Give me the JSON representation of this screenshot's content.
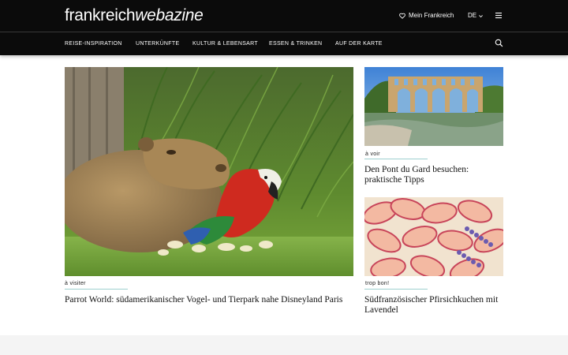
{
  "header": {
    "logo_part1": "frankreich",
    "logo_part2": "webazine",
    "favorites_label": "Mein Frankreich",
    "language": "DE"
  },
  "nav": {
    "items": [
      {
        "label": "REISE-INSPIRATION"
      },
      {
        "label": "UNTERKÜNFTE"
      },
      {
        "label": "KULTUR & LEBENSART"
      },
      {
        "label": "ESSEN & TRINKEN"
      },
      {
        "label": "AUF DER KARTE"
      }
    ]
  },
  "articles": [
    {
      "category": "à visiter",
      "title": "Parrot World: südamerikanischer Vogel- und Tierpark nahe Disneyland Paris"
    },
    {
      "category": "à voir",
      "title": "Den Pont du Gard besuchen: praktische Tipps"
    },
    {
      "category": "trop bon!",
      "title": "Südfranzösischer Pfirsichkuchen mit Lavendel"
    }
  ],
  "colors": {
    "header_bg": "#0b0b0b",
    "accent_line": "#9ed0cf",
    "footer_band": "#f4f4f4"
  },
  "icons": [
    "heart-icon",
    "chevron-down-icon",
    "menu-icon",
    "search-icon"
  ]
}
